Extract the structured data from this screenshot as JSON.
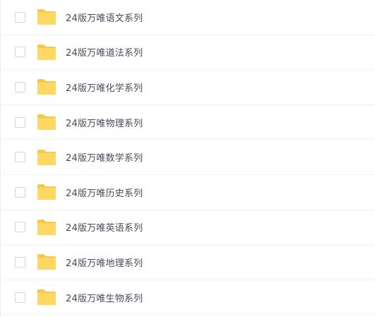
{
  "file_list": {
    "items": [
      {
        "name": "24版万唯语文系列",
        "icon": "folder-icon",
        "checked": false
      },
      {
        "name": "24版万唯道法系列",
        "icon": "folder-icon",
        "checked": false
      },
      {
        "name": "24版万唯化学系列",
        "icon": "folder-icon",
        "checked": false
      },
      {
        "name": "24版万唯物理系列",
        "icon": "folder-icon",
        "checked": false
      },
      {
        "name": "24版万唯数学系列",
        "icon": "folder-icon",
        "checked": false
      },
      {
        "name": "24版万唯历史系列",
        "icon": "folder-icon",
        "checked": false
      },
      {
        "name": "24版万唯英语系列",
        "icon": "folder-icon",
        "checked": false
      },
      {
        "name": "24版万唯地理系列",
        "icon": "folder-icon",
        "checked": false
      },
      {
        "name": "24版万唯生物系列",
        "icon": "folder-icon",
        "checked": false
      }
    ]
  },
  "colors": {
    "folder_back": "#F7C948",
    "folder_front": "#FFD863",
    "text": "#454D5A",
    "checkbox_border": "#D6D6D6",
    "row_divider": "#F2F2F2"
  }
}
